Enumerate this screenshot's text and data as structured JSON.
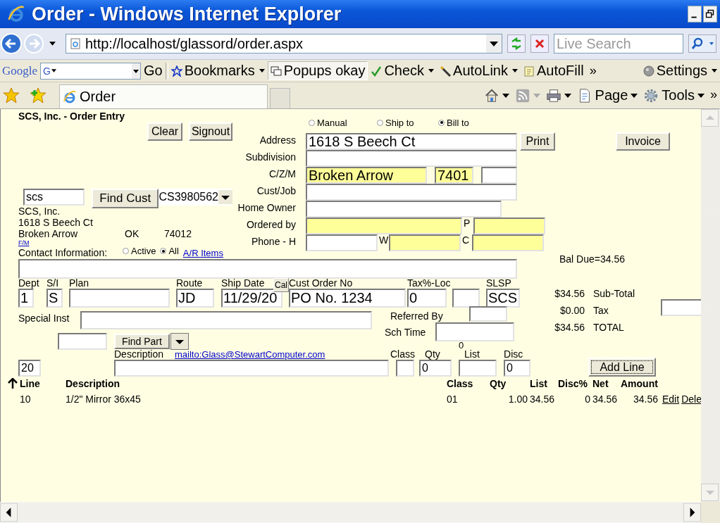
{
  "window": {
    "title": "Order - Windows Internet Explorer"
  },
  "address_bar": {
    "url": "http://localhost/glassord/order.aspx",
    "search_placeholder": "Live Search"
  },
  "google_toolbar": {
    "logo": "Google",
    "engine": "G",
    "go": "Go",
    "items": [
      {
        "label": "Bookmarks",
        "kind": "menu",
        "pressed": false
      },
      {
        "label": "Popups okay",
        "kind": "button",
        "pressed": true
      },
      {
        "label": "Check",
        "kind": "menu",
        "pressed": false
      },
      {
        "label": "AutoLink",
        "kind": "menu",
        "pressed": false
      },
      {
        "label": "AutoFill",
        "kind": "button",
        "pressed": false
      }
    ],
    "overflow": "»",
    "settings": "Settings"
  },
  "tabs": [
    {
      "label": "Order",
      "selected": true
    }
  ],
  "command_bar": {
    "icons": [
      {
        "disabled": false
      },
      {
        "disabled": true
      },
      {
        "disabled": false
      }
    ],
    "menus": [
      "Page",
      "Tools"
    ],
    "overflow": "»"
  },
  "form": {
    "title": "SCS, Inc. - Order Entry",
    "address_source": [
      {
        "label": "Manual",
        "selected": false
      },
      {
        "label": "Ship to",
        "selected": false
      },
      {
        "label": "Bill to",
        "selected": true
      }
    ],
    "clear": "Clear",
    "signout": "Signout",
    "print": "Print",
    "invoice": "Invoice",
    "customer_search": {
      "value": "scs",
      "button": "Find Cust",
      "customer_id": "CS3980562"
    },
    "customer": {
      "name": "SCS, Inc.",
      "street": "1618 S Beech Ct",
      "city": "Broken Arrow",
      "state": "OK",
      "zip": "74012"
    },
    "fm_link": "F/M",
    "contact_label": "Contact Information:",
    "status_filter": [
      {
        "label": "Active",
        "selected": false
      },
      {
        "label": "All",
        "selected": true
      }
    ],
    "ar_link": "A/R Items",
    "address_fields": [
      {
        "label": "Address",
        "inputs": [
          {
            "value": "1618 S Beech Ct",
            "required": false
          }
        ]
      },
      {
        "label": "Subdivision",
        "inputs": [
          {
            "required": false
          }
        ]
      },
      {
        "label": "C/Z/M",
        "inputs": [
          {
            "value": "Broken Arrow",
            "required": true
          },
          {
            "value": "7401",
            "required": true
          },
          {
            "required": false
          }
        ]
      },
      {
        "label": "Cust/Job",
        "inputs": [
          {
            "required": false
          }
        ]
      },
      {
        "label": "Home Owner",
        "inputs": [
          {
            "required": false
          }
        ]
      },
      {
        "label": "Ordered by",
        "inputs": [
          {
            "required": true
          },
          {
            "label": "P",
            "required": true
          }
        ]
      },
      {
        "label": "Phone - H",
        "inputs": [
          {
            "required": false
          },
          {
            "label": "W",
            "required": true
          },
          {
            "label": "C",
            "required": true
          }
        ]
      }
    ],
    "bal_due": "Bal Due=34.56",
    "order_header": [
      {
        "label": "Dept",
        "value": "1",
        "kind": "single"
      },
      {
        "label": "S/I",
        "value": "S",
        "kind": "single"
      },
      {
        "label": "Plan",
        "kind": "single"
      },
      {
        "label": "Route",
        "value": "JD",
        "kind": "single"
      },
      {
        "label": "Ship Date",
        "value": "11/29/20",
        "kind": "date",
        "cal": "Cal"
      },
      {
        "label": "Cust Order No",
        "value": "PO No. 1234",
        "kind": "single"
      },
      {
        "label": "Tax%-Loc",
        "value": "0",
        "kind": "pair"
      },
      {
        "label": "SLSP",
        "value": "SCS",
        "kind": "single"
      }
    ],
    "special_inst": "Special Inst",
    "referred_by": "Referred By",
    "sch_time": "Sch Time",
    "sch_counter": "0",
    "totals": [
      {
        "amount": "$34.56",
        "label": "Sub-Total"
      },
      {
        "amount": "$0.00",
        "label": "Tax"
      },
      {
        "amount": "$34.56",
        "label": "TOTAL"
      }
    ],
    "find_part": "Find Part",
    "line_entry": {
      "line_no": "20",
      "description_label": "Description",
      "mailto": "mailto:Glass@StewartComputer.com",
      "class_label": "Class",
      "qty_label": "Qty",
      "qty": "0",
      "list_label": "List",
      "disc_label": "Disc",
      "disc": "0",
      "add_button": "Add Line"
    },
    "lines_table": {
      "columns": [
        "Line",
        "Description",
        "Class",
        "Qty",
        "List",
        "Disc%",
        "Net",
        "Amount"
      ],
      "rows": [
        {
          "cells": [
            "10",
            "1/2\" Mirror 36x45",
            "01",
            "1.00",
            "34.56",
            "0",
            "34.56",
            "34.56"
          ],
          "actions": [
            "Edit",
            "Dele"
          ]
        }
      ]
    }
  }
}
